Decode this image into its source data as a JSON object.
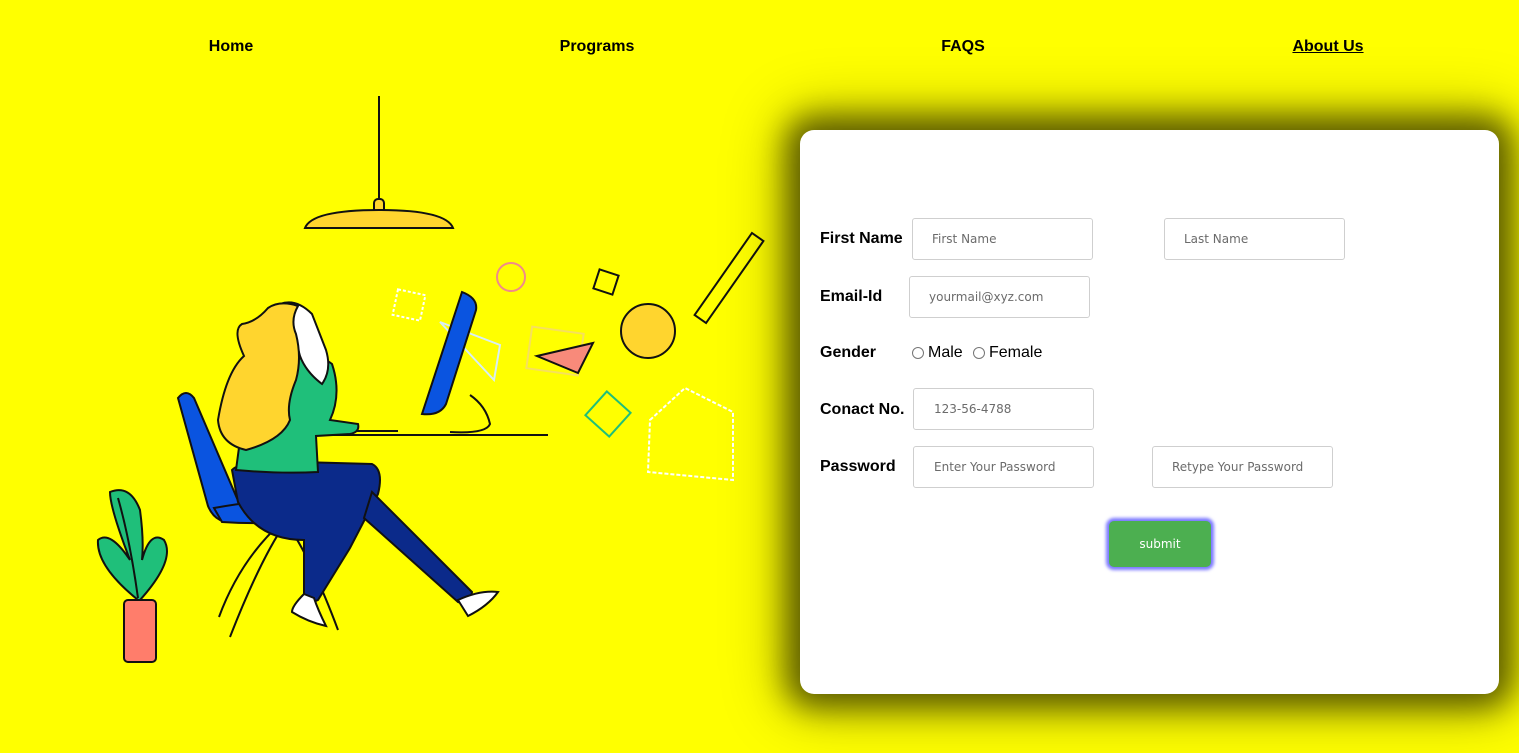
{
  "nav": {
    "items": [
      {
        "label": "Home"
      },
      {
        "label": "Programs"
      },
      {
        "label": "FAQS"
      },
      {
        "label": "About Us"
      }
    ]
  },
  "form": {
    "first_name_label": "First Name",
    "first_name_placeholder": "First Name",
    "last_name_placeholder": "Last Name",
    "email_label": "Email-Id",
    "email_placeholder": "yourmail@xyz.com",
    "gender_label": "Gender",
    "gender_options": [
      "Male",
      "Female"
    ],
    "contact_label": "Conact No.",
    "contact_placeholder": "123-56-4788",
    "password_label": "Password",
    "password_placeholder": "Enter Your Password",
    "retype_placeholder": "Retype Your Password",
    "submit_label": "submit"
  },
  "colors": {
    "background": "#ffff00",
    "submit": "#4caf50",
    "chair": "#0a54e0",
    "hair": "#ffd52e",
    "shirt": "#1fbf7a",
    "pants": "#0b2a8a",
    "pot": "#ff7d6b"
  }
}
